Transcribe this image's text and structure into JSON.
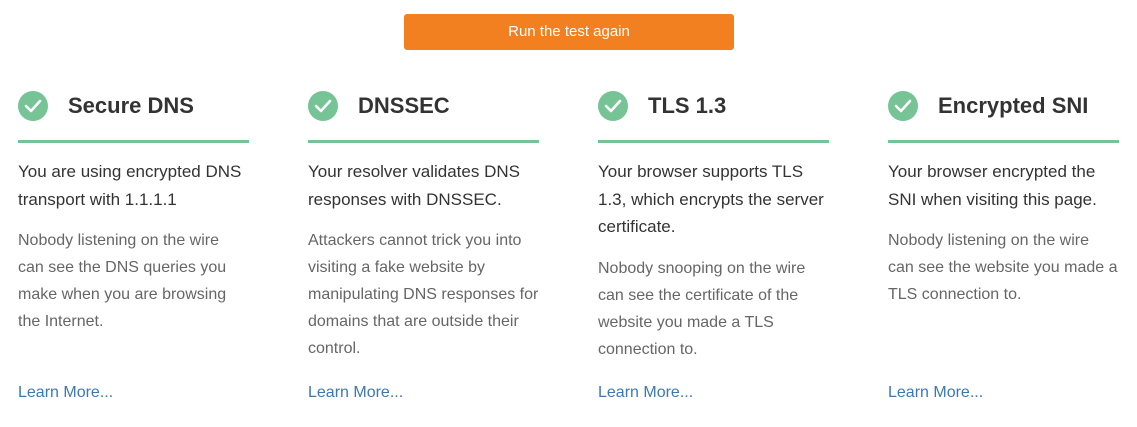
{
  "action": {
    "run_again_label": "Run the test again"
  },
  "colors": {
    "accent_orange": "#f38020",
    "success_green": "#76c496",
    "link_blue": "#3c78b4"
  },
  "cards": [
    {
      "icon": "check-circle-icon",
      "title": "Secure DNS",
      "status": "You are using encrypted DNS transport with 1.1.1.1",
      "detail": "Nobody listening on the wire can see the DNS queries you make when you are browsing the Internet.",
      "learn_more": "Learn More..."
    },
    {
      "icon": "check-circle-icon",
      "title": "DNSSEC",
      "status": "Your resolver validates DNS responses with DNSSEC.",
      "detail": "Attackers cannot trick you into visiting a fake website by manipulating DNS responses for domains that are outside their control.",
      "learn_more": "Learn More..."
    },
    {
      "icon": "check-circle-icon",
      "title": "TLS 1.3",
      "status": "Your browser supports TLS 1.3, which encrypts the server certificate.",
      "detail": "Nobody snooping on the wire can see the certificate of the website you made a TLS connection to.",
      "learn_more": "Learn More..."
    },
    {
      "icon": "check-circle-icon",
      "title": "Encrypted SNI",
      "status": "Your browser encrypted the SNI when visiting this page.",
      "detail": "Nobody listening on the wire can see the website you made a TLS connection to.",
      "learn_more": "Learn More..."
    }
  ]
}
